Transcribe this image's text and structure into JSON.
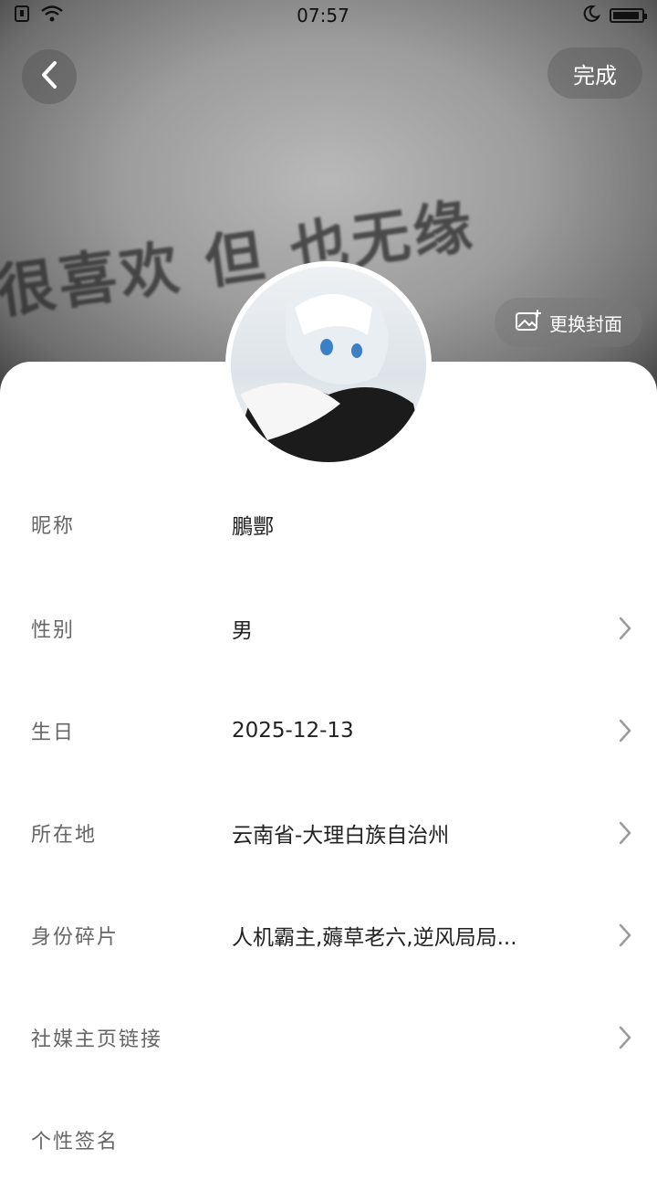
{
  "status_bar": {
    "time": "07:57"
  },
  "header": {
    "done_label": "完成",
    "change_cover_label": "更换封面"
  },
  "cover": {
    "text": "很喜欢 但 也无缘"
  },
  "profile_rows": [
    {
      "label": "昵称",
      "value": "鵬酆",
      "has_arrow": false
    },
    {
      "label": "性别",
      "value": "男",
      "has_arrow": true
    },
    {
      "label": "生日",
      "value": "2025-12-13",
      "has_arrow": true
    },
    {
      "label": "所在地",
      "value": "云南省-大理白族自治州",
      "has_arrow": true
    },
    {
      "label": "身份碎片",
      "value": "人机霸主,薅草老六,逆风局局...",
      "has_arrow": true
    },
    {
      "label": "社媒主页链接",
      "value": "",
      "has_arrow": true
    },
    {
      "label": "个性签名",
      "value": "",
      "has_arrow": false
    }
  ]
}
